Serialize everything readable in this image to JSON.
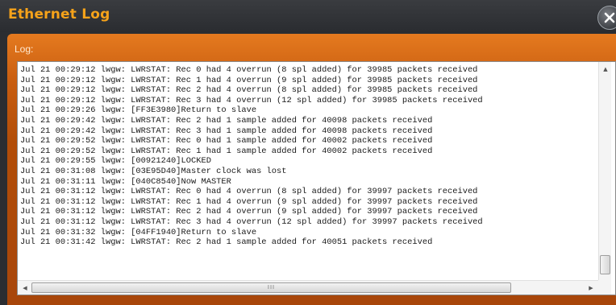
{
  "window": {
    "title": "Ethernet Log",
    "close_icon": "close-icon"
  },
  "panel": {
    "label": "Log:"
  },
  "log": {
    "lines": [
      "Jul 21 00:29:12 lwgw: LWRSTAT: Rec 0 had 4 overrun (8 spl added) for 39985 packets received",
      "Jul 21 00:29:12 lwgw: LWRSTAT: Rec 1 had 4 overrun (9 spl added) for 39985 packets received",
      "Jul 21 00:29:12 lwgw: LWRSTAT: Rec 2 had 4 overrun (8 spl added) for 39985 packets received",
      "Jul 21 00:29:12 lwgw: LWRSTAT: Rec 3 had 4 overrun (12 spl added) for 39985 packets received",
      "Jul 21 00:29:26 lwgw: [FF3E3980]Return to slave",
      "Jul 21 00:29:42 lwgw: LWRSTAT: Rec 2 had 1 sample added for 40098 packets received",
      "Jul 21 00:29:42 lwgw: LWRSTAT: Rec 3 had 1 sample added for 40098 packets received",
      "Jul 21 00:29:52 lwgw: LWRSTAT: Rec 0 had 1 sample added for 40002 packets received",
      "Jul 21 00:29:52 lwgw: LWRSTAT: Rec 1 had 1 sample added for 40002 packets received",
      "Jul 21 00:29:55 lwgw: [00921240]LOCKED",
      "Jul 21 00:31:08 lwgw: [03E95D40]Master clock was lost",
      "Jul 21 00:31:11 lwgw: [040C8540]Now MASTER",
      "Jul 21 00:31:12 lwgw: LWRSTAT: Rec 0 had 4 overrun (8 spl added) for 39997 packets received",
      "Jul 21 00:31:12 lwgw: LWRSTAT: Rec 1 had 4 overrun (9 spl added) for 39997 packets received",
      "Jul 21 00:31:12 lwgw: LWRSTAT: Rec 2 had 4 overrun (9 spl added) for 39997 packets received",
      "Jul 21 00:31:12 lwgw: LWRSTAT: Rec 3 had 4 overrun (12 spl added) for 39997 packets received",
      "Jul 21 00:31:32 lwgw: [04FF1940]Return to slave",
      "Jul 21 00:31:42 lwgw: LWRSTAT: Rec 2 had 1 sample added for 40051 packets received"
    ]
  },
  "scrollbars": {
    "vertical_up_icon": "arrow-up-icon",
    "horizontal_left_icon": "arrow-left-icon",
    "horizontal_right_icon": "arrow-right-icon",
    "horizontal_grip": "III"
  },
  "colors": {
    "title": "#f5a21a",
    "panel_orange": "#c85d10",
    "background": "#2b2d31"
  }
}
